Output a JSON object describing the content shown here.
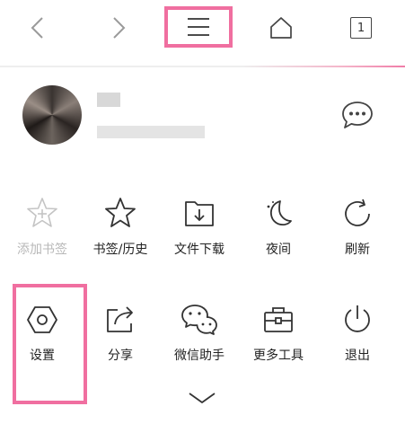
{
  "toolbar": {
    "tab_count": "1",
    "icons": [
      "chevron-left-icon",
      "chevron-right-icon",
      "hamburger-menu-icon",
      "home-icon",
      "tab-count-icon"
    ]
  },
  "user": {
    "message_icon": "chat-bubble-icon"
  },
  "menu_row1": [
    {
      "label": "添加书签",
      "icon": "star-plus-icon",
      "disabled": true
    },
    {
      "label": "书签/历史",
      "icon": "star-icon"
    },
    {
      "label": "文件下载",
      "icon": "folder-download-icon"
    },
    {
      "label": "夜间",
      "icon": "moon-icon"
    },
    {
      "label": "刷新",
      "icon": "refresh-icon"
    }
  ],
  "menu_row2": [
    {
      "label": "设置",
      "icon": "hexagon-settings-icon"
    },
    {
      "label": "分享",
      "icon": "share-icon"
    },
    {
      "label": "微信助手",
      "icon": "wechat-icon"
    },
    {
      "label": "更多工具",
      "icon": "toolbox-icon"
    },
    {
      "label": "退出",
      "icon": "power-icon"
    }
  ],
  "colors": {
    "highlight": "#f06fa0",
    "icon": "#333333",
    "disabled": "#b8b8b8"
  }
}
